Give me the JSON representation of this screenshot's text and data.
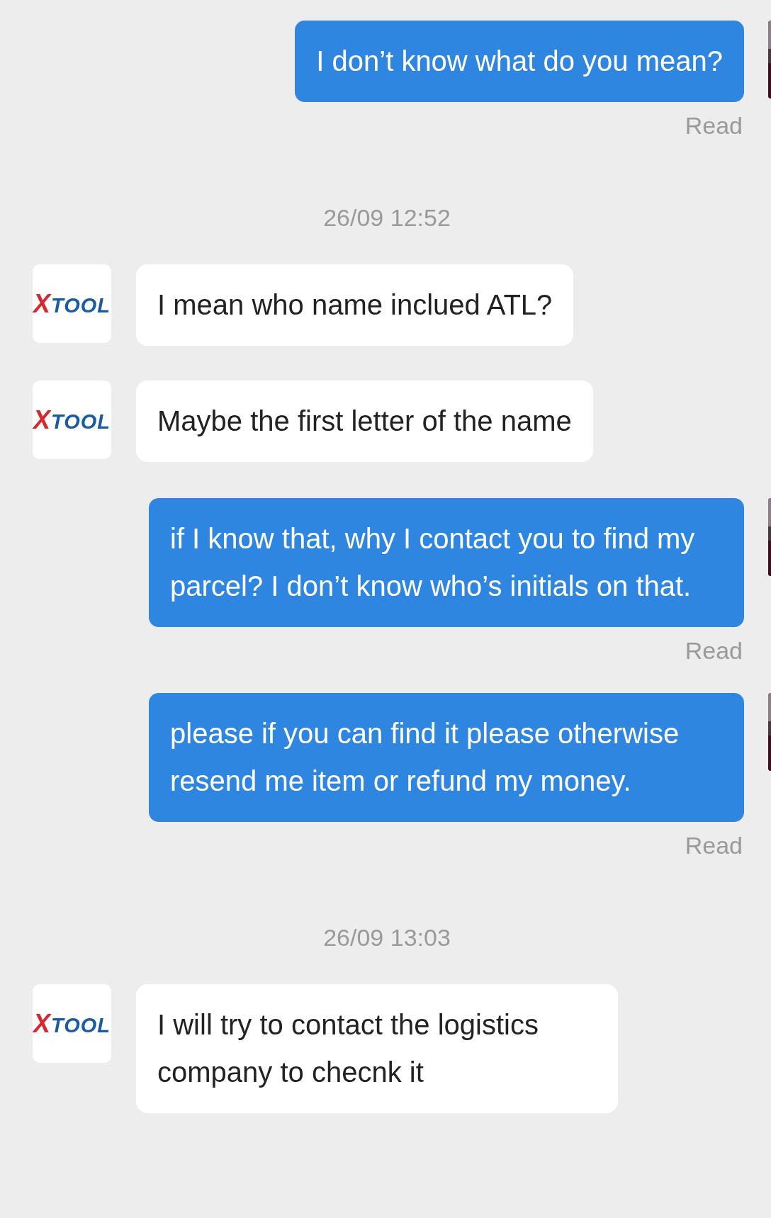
{
  "messages": [
    {
      "kind": "sent",
      "text": "I don’t know what do you mean?",
      "status": "Read"
    },
    {
      "kind": "time",
      "text": "26/09 12:52"
    },
    {
      "kind": "received",
      "logo": "XTOOL",
      "text": "I mean who name inclued ATL?"
    },
    {
      "kind": "received",
      "logo": "XTOOL",
      "text": "Maybe the first letter of the name"
    },
    {
      "kind": "sent",
      "text": "if I know that, why I contact you to find my parcel? I don’t know who’s initials on that.",
      "status": "Read"
    },
    {
      "kind": "sent",
      "text": "please if you can find it please otherwise resend me item or refund my money.",
      "status": "Read"
    },
    {
      "kind": "time",
      "text": "26/09 13:03"
    },
    {
      "kind": "received",
      "logo": "XTOOL",
      "text": "I will try to contact the logistics company to checnk it"
    }
  ]
}
